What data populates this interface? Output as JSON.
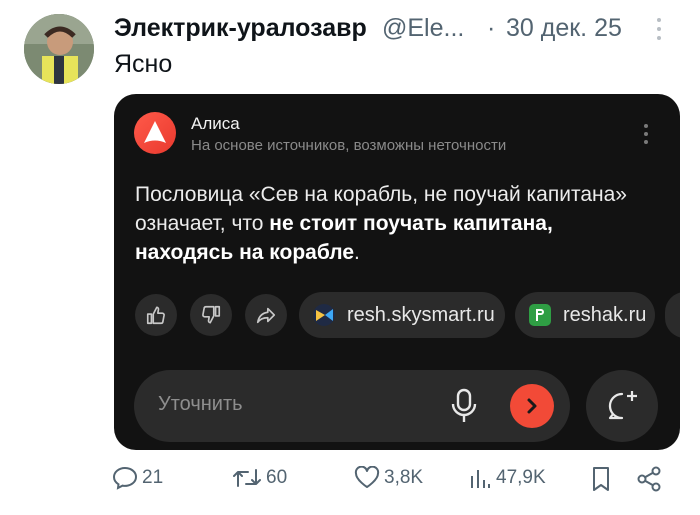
{
  "post": {
    "author_name": "Электрик-уралозавр",
    "author_handle": "@Ele...",
    "separator": "·",
    "date": "30 дек. 25",
    "text": "Ясно",
    "avatar_icon": "avatar-photo-icon",
    "more_icon": "more-vertical-icon"
  },
  "alisa_card": {
    "assistant_name": "Алиса",
    "subtitle": "На основе источников, возможны неточности",
    "answer_plain_1": "Пословица «Сев на корабль, не поучай капитана» означает, что ",
    "answer_bold": "не стоит поучать капитана, находясь на корабле",
    "answer_plain_2": ".",
    "sources": [
      {
        "label": "resh.skysmart.ru",
        "icon": "skysmart-favicon-icon"
      },
      {
        "label": "reshak.ru",
        "icon": "reshak-favicon-icon"
      }
    ],
    "actions": [
      "thumbs-up-icon",
      "thumbs-down-icon",
      "share-icon"
    ],
    "input_placeholder": "Уточнить",
    "accent_color": "#f24a37",
    "card_bg": "#121212"
  },
  "actions": {
    "replies": "21",
    "reposts": "60",
    "likes": "3,8K",
    "views": "47,9K"
  }
}
